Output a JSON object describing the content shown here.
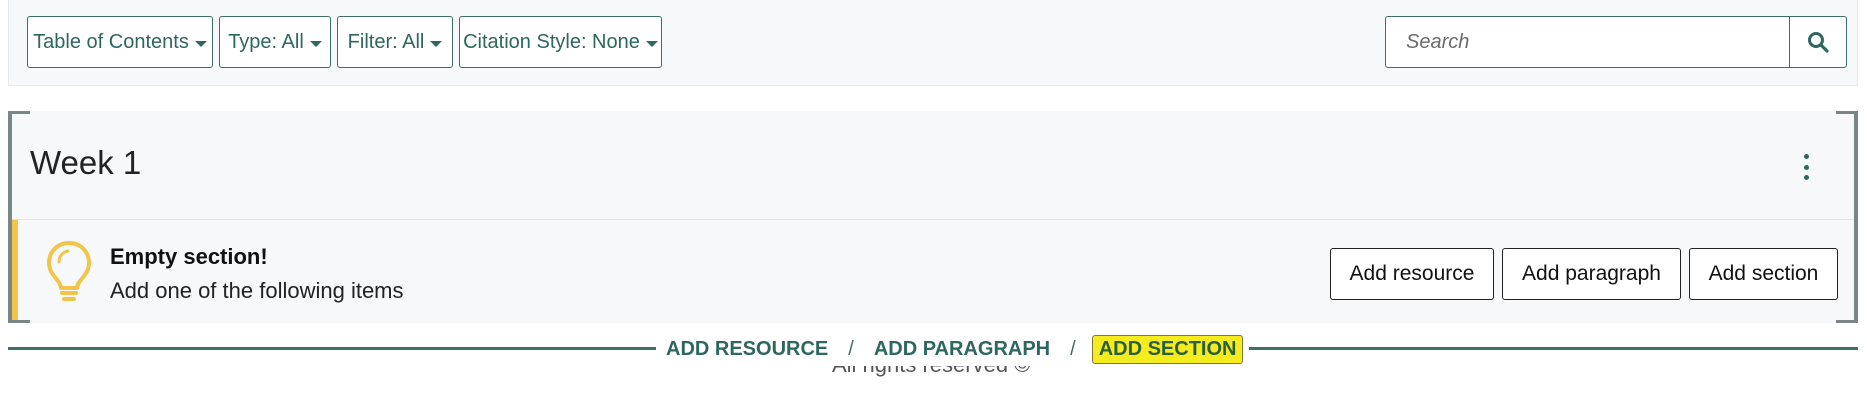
{
  "toolbar": {
    "table_of_contents": "Table of Contents",
    "type_filter": "Type: All",
    "filter": "Filter: All",
    "citation_style": "Citation Style: None",
    "search_placeholder": "Search",
    "search_icon": "search-icon"
  },
  "section": {
    "title": "Week 1",
    "menu_icon": "vertical-ellipsis-icon",
    "empty_title": "Empty section!",
    "empty_subtitle": "Add one of the following items",
    "empty_icon": "lightbulb-icon",
    "buttons": {
      "add_resource": "Add resource",
      "add_paragraph": "Add paragraph",
      "add_section": "Add section"
    }
  },
  "add_line": {
    "add_resource": "ADD RESOURCE",
    "add_paragraph": "ADD PARAGRAPH",
    "add_section": "ADD SECTION",
    "separator": "/"
  },
  "footer": {
    "text": "All rights reserved ©"
  },
  "colors": {
    "accent": "#3d6e68",
    "warning": "#f1c54a",
    "highlight": "#f5ec1f"
  }
}
